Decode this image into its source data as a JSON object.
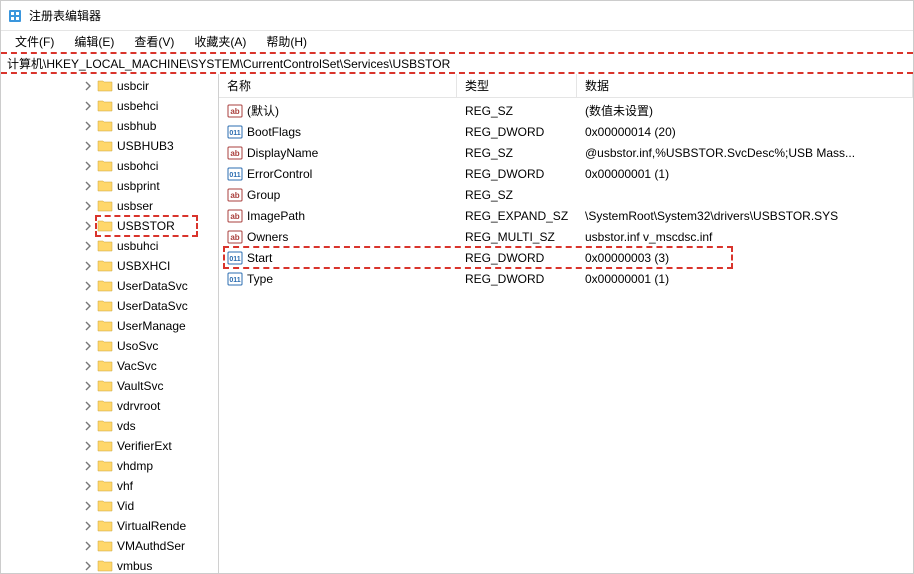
{
  "window": {
    "title": "注册表编辑器"
  },
  "menu": {
    "file": "文件(F)",
    "edit": "编辑(E)",
    "view": "查看(V)",
    "favorites": "收藏夹(A)",
    "help": "帮助(H)"
  },
  "address": "计算机\\HKEY_LOCAL_MACHINE\\SYSTEM\\CurrentControlSet\\Services\\USBSTOR",
  "tree": [
    {
      "label": "usbcir",
      "expanded": false
    },
    {
      "label": "usbehci",
      "expanded": false
    },
    {
      "label": "usbhub",
      "expanded": false
    },
    {
      "label": "USBHUB3",
      "expanded": false
    },
    {
      "label": "usbohci",
      "expanded": false
    },
    {
      "label": "usbprint",
      "expanded": false
    },
    {
      "label": "usbser",
      "expanded": false
    },
    {
      "label": "USBSTOR",
      "expanded": false,
      "highlight": true
    },
    {
      "label": "usbuhci",
      "expanded": false
    },
    {
      "label": "USBXHCI",
      "expanded": false
    },
    {
      "label": "UserDataSvc",
      "expanded": false
    },
    {
      "label": "UserDataSvc",
      "expanded": false
    },
    {
      "label": "UserManage",
      "expanded": false
    },
    {
      "label": "UsoSvc",
      "expanded": false
    },
    {
      "label": "VacSvc",
      "expanded": false
    },
    {
      "label": "VaultSvc",
      "expanded": false
    },
    {
      "label": "vdrvroot",
      "expanded": false
    },
    {
      "label": "vds",
      "expanded": false
    },
    {
      "label": "VerifierExt",
      "expanded": false
    },
    {
      "label": "vhdmp",
      "expanded": false
    },
    {
      "label": "vhf",
      "expanded": false
    },
    {
      "label": "Vid",
      "expanded": false
    },
    {
      "label": "VirtualRende",
      "expanded": false
    },
    {
      "label": "VMAuthdSer",
      "expanded": false
    },
    {
      "label": "vmbus",
      "expanded": false
    }
  ],
  "columns": {
    "name": "名称",
    "type": "类型",
    "data": "数据"
  },
  "rows": [
    {
      "icon": "sz",
      "name": "(默认)",
      "type": "REG_SZ",
      "data": "(数值未设置)"
    },
    {
      "icon": "bin",
      "name": "BootFlags",
      "type": "REG_DWORD",
      "data": "0x00000014 (20)"
    },
    {
      "icon": "sz",
      "name": "DisplayName",
      "type": "REG_SZ",
      "data": "@usbstor.inf,%USBSTOR.SvcDesc%;USB Mass..."
    },
    {
      "icon": "bin",
      "name": "ErrorControl",
      "type": "REG_DWORD",
      "data": "0x00000001 (1)"
    },
    {
      "icon": "sz",
      "name": "Group",
      "type": "REG_SZ",
      "data": ""
    },
    {
      "icon": "sz",
      "name": "ImagePath",
      "type": "REG_EXPAND_SZ",
      "data": "\\SystemRoot\\System32\\drivers\\USBSTOR.SYS"
    },
    {
      "icon": "sz",
      "name": "Owners",
      "type": "REG_MULTI_SZ",
      "data": "usbstor.inf v_mscdsc.inf"
    },
    {
      "icon": "bin",
      "name": "Start",
      "type": "REG_DWORD",
      "data": "0x00000003 (3)",
      "highlight": true
    },
    {
      "icon": "bin",
      "name": "Type",
      "type": "REG_DWORD",
      "data": "0x00000001 (1)"
    }
  ],
  "chart_data": {
    "type": "table",
    "columns": [
      "名称",
      "类型",
      "数据"
    ],
    "rows": [
      [
        "(默认)",
        "REG_SZ",
        "(数值未设置)"
      ],
      [
        "BootFlags",
        "REG_DWORD",
        "0x00000014 (20)"
      ],
      [
        "DisplayName",
        "REG_SZ",
        "@usbstor.inf,%USBSTOR.SvcDesc%;USB Mass..."
      ],
      [
        "ErrorControl",
        "REG_DWORD",
        "0x00000001 (1)"
      ],
      [
        "Group",
        "REG_SZ",
        ""
      ],
      [
        "ImagePath",
        "REG_EXPAND_SZ",
        "\\SystemRoot\\System32\\drivers\\USBSTOR.SYS"
      ],
      [
        "Owners",
        "REG_MULTI_SZ",
        "usbstor.inf v_mscdsc.inf"
      ],
      [
        "Start",
        "REG_DWORD",
        "0x00000003 (3)"
      ],
      [
        "Type",
        "REG_DWORD",
        "0x00000001 (1)"
      ]
    ]
  }
}
